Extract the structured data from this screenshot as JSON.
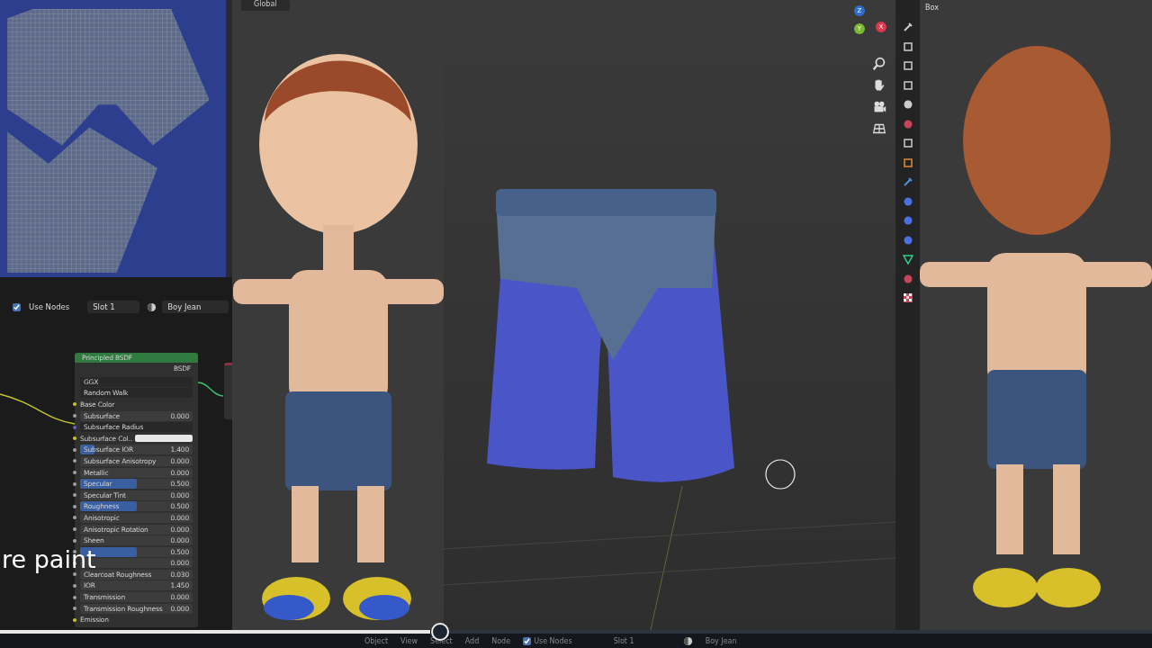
{
  "viewport_left": {
    "orientation": "Global"
  },
  "viewport_main": {
    "gizmo_axes": [
      {
        "label": "Z",
        "color": "#2f6fd0"
      },
      {
        "label": "X",
        "color": "#e0374f"
      },
      {
        "label": "Y",
        "color": "#7cb82f"
      }
    ]
  },
  "properties": {
    "header": "Box"
  },
  "node_header": {
    "use_nodes": {
      "label": "Use Nodes",
      "checked": true
    },
    "slot": "Slot 1",
    "material": "Boy Jean"
  },
  "node": {
    "title": "Principled BSDF",
    "output": "BSDF",
    "rows": [
      {
        "kind": "dropdown",
        "label": "GGX"
      },
      {
        "kind": "dropdown",
        "label": "Random Walk"
      },
      {
        "kind": "socket",
        "label": "Base Color",
        "color": "#c7c729"
      },
      {
        "kind": "slider",
        "label": "Subsurface",
        "value": "0.000",
        "level": 0,
        "color": "#a1a1a1"
      },
      {
        "kind": "dropdown",
        "label": "Subsurface Radius",
        "color": "#6363c7"
      },
      {
        "kind": "color",
        "label": "Subsurface Col..",
        "color": "#c7c729"
      },
      {
        "kind": "slider",
        "label": "Subsurface IOR",
        "value": "1.400",
        "level": 0.13,
        "color": "#a1a1a1"
      },
      {
        "kind": "slider",
        "label": "Subsurface Anisotropy",
        "value": "0.000",
        "level": 0,
        "color": "#a1a1a1"
      },
      {
        "kind": "slider",
        "label": "Metallic",
        "value": "0.000",
        "level": 0,
        "color": "#a1a1a1"
      },
      {
        "kind": "slider",
        "label": "Specular",
        "value": "0.500",
        "level": 0.5,
        "color": "#a1a1a1"
      },
      {
        "kind": "slider",
        "label": "Specular Tint",
        "value": "0.000",
        "level": 0,
        "color": "#a1a1a1"
      },
      {
        "kind": "slider",
        "label": "Roughness",
        "value": "0.500",
        "level": 0.5,
        "color": "#a1a1a1"
      },
      {
        "kind": "slider",
        "label": "Anisotropic",
        "value": "0.000",
        "level": 0,
        "color": "#a1a1a1"
      },
      {
        "kind": "slider",
        "label": "Anisotropic Rotation",
        "value": "0.000",
        "level": 0,
        "color": "#a1a1a1"
      },
      {
        "kind": "slider",
        "label": "Sheen",
        "value": "0.000",
        "level": 0,
        "color": "#a1a1a1"
      },
      {
        "kind": "slider",
        "value": "0.500",
        "level": 0.5,
        "color": "#a1a1a1"
      },
      {
        "kind": "slider",
        "value": "0.000",
        "level": 0,
        "color": "#a1a1a1"
      },
      {
        "kind": "slider",
        "label": "Clearcoat Roughness",
        "value": "0.030",
        "level": 0,
        "color": "#a1a1a1"
      },
      {
        "kind": "slider",
        "label": "IOR",
        "value": "1.450",
        "level": 0,
        "color": "#a1a1a1"
      },
      {
        "kind": "slider",
        "label": "Transmission",
        "value": "0.000",
        "level": 0,
        "color": "#a1a1a1"
      },
      {
        "kind": "slider",
        "label": "Transmission Roughness",
        "value": "0.000",
        "level": 0,
        "color": "#a1a1a1"
      },
      {
        "kind": "socket",
        "label": "Emission",
        "color": "#c7c729"
      }
    ]
  },
  "caption": "re paint",
  "timeline": {
    "level": 0.381
  },
  "status_bar": {
    "mode": "Object",
    "menus": [
      "View",
      "Select",
      "Add",
      "Node"
    ],
    "use_nodes": {
      "label": "Use Nodes",
      "checked": true
    },
    "slot": "Slot 1",
    "material": "Boy Jean"
  }
}
